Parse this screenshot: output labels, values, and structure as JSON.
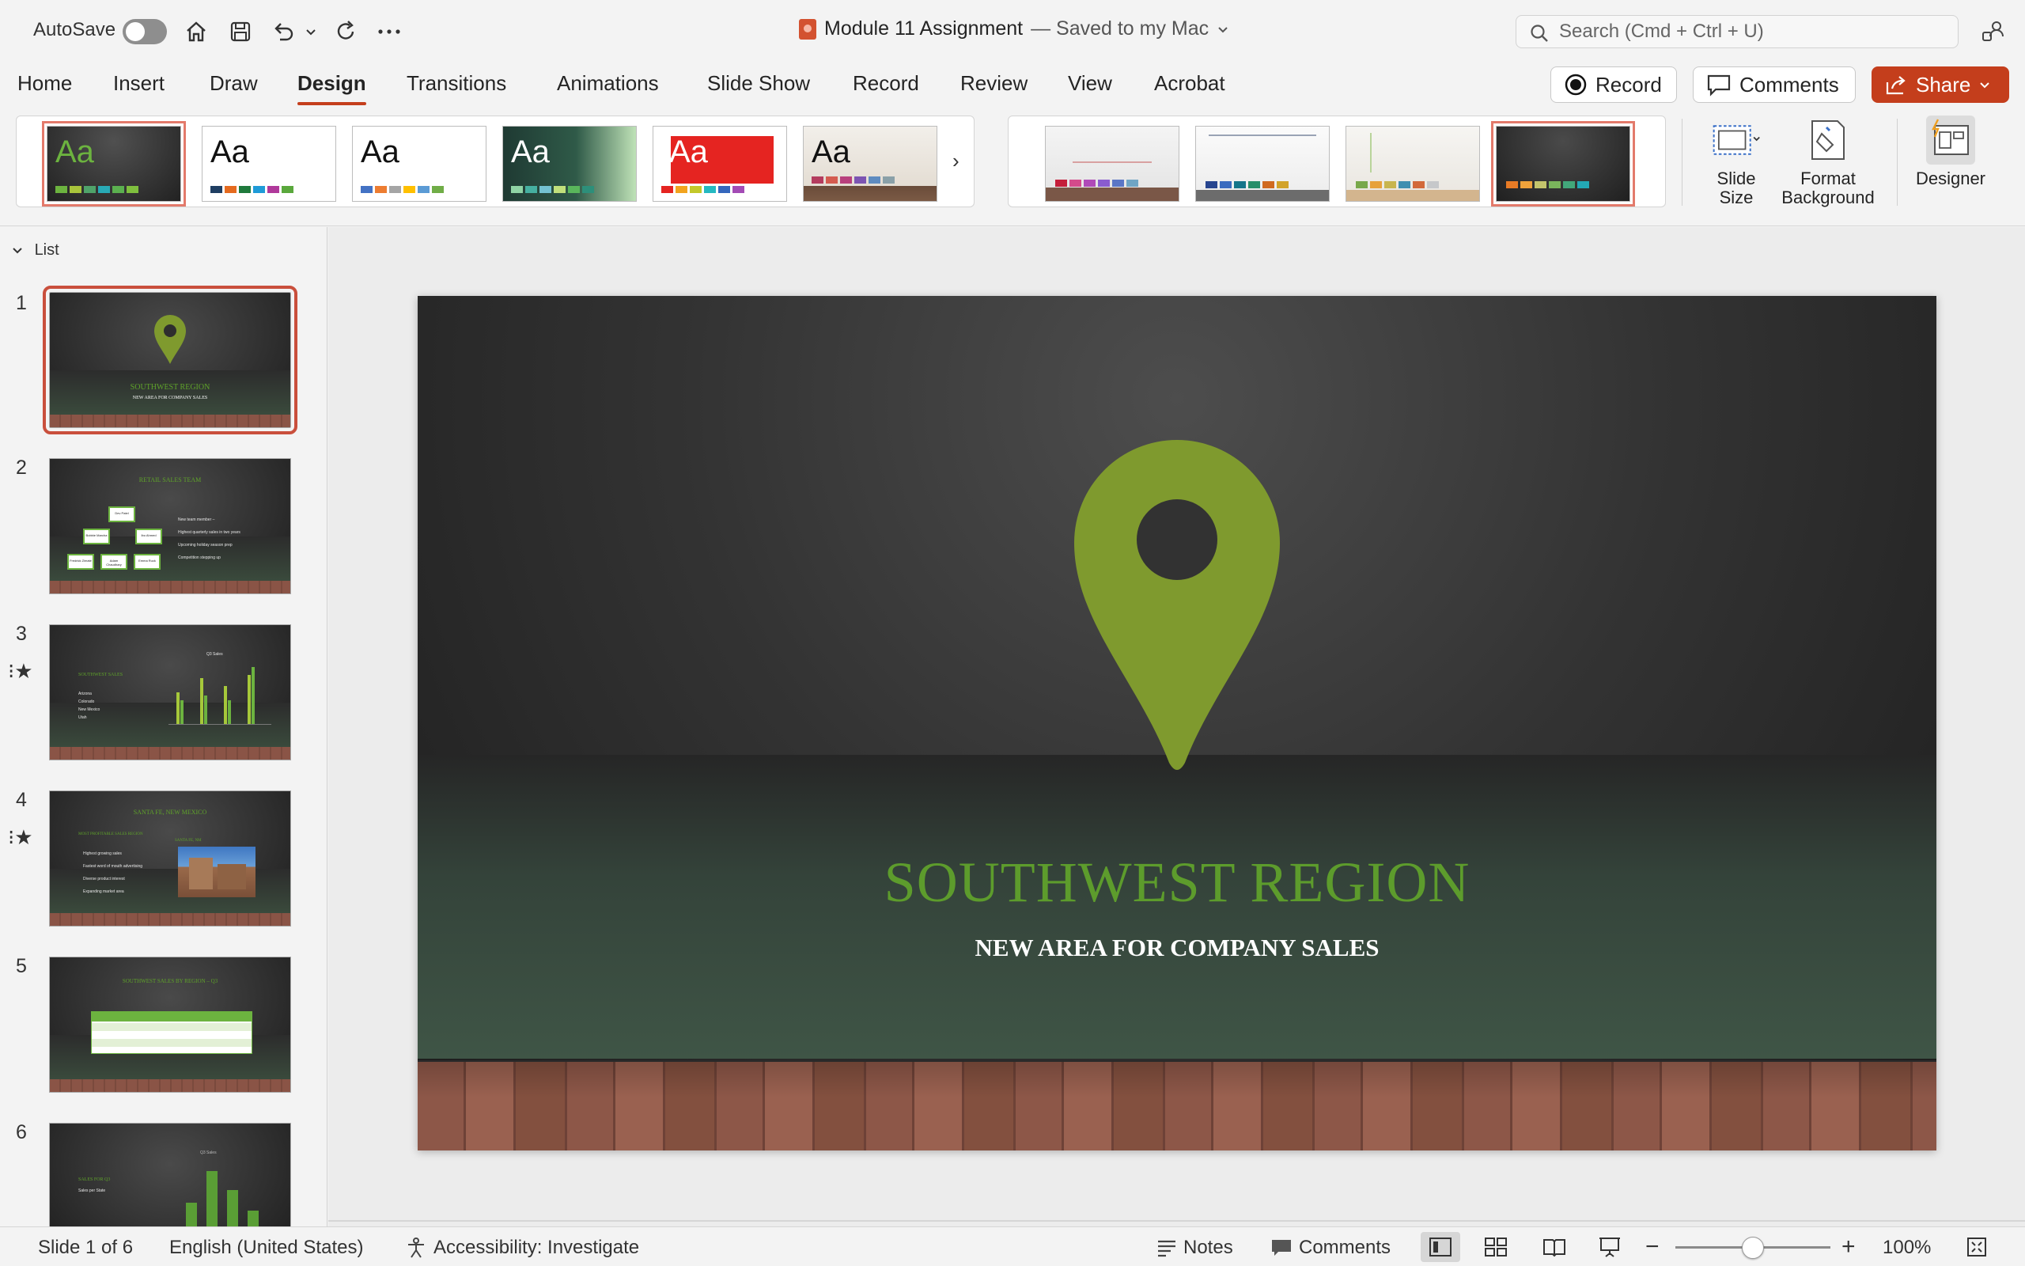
{
  "titlebar": {
    "autosave_label": "AutoSave",
    "doc_name": "Module 11 Assignment",
    "doc_status": "— Saved to my Mac",
    "search_placeholder": "Search (Cmd + Ctrl + U)"
  },
  "tabs": [
    "Home",
    "Insert",
    "Draw",
    "Design",
    "Transitions",
    "Animations",
    "Slide Show",
    "Record",
    "Review",
    "View",
    "Acrobat"
  ],
  "active_tab": "Design",
  "actions": {
    "record_label": "Record",
    "comments_label": "Comments",
    "share_label": "Share"
  },
  "themes": [
    {
      "name": "Aa",
      "bg": "#2b2b2b",
      "fg": "#6cb33f"
    },
    {
      "name": "Aa",
      "bg": "#ffffff",
      "fg": "#111111"
    },
    {
      "name": "Aa",
      "bg": "#ffffff",
      "fg": "#111111"
    },
    {
      "name": "Aa",
      "bg": "#23433a",
      "fg": "#ffffff"
    },
    {
      "name": "Aa",
      "bg": "#ffffff",
      "fg": "#ffffff"
    },
    {
      "name": "Aa",
      "bg": "#efebe5",
      "fg": "#111111"
    }
  ],
  "ribbon": {
    "slide_size_label1": "Slide",
    "slide_size_label2": "Size",
    "format_bg_label1": "Format",
    "format_bg_label2": "Background",
    "designer_label": "Designer"
  },
  "pane": {
    "list_label": "List",
    "slides": [
      {
        "num": "1",
        "title": "SOUTHWEST REGION",
        "sub": "NEW AREA FOR COMPANY SALES"
      },
      {
        "num": "2",
        "title": "RETAIL SALES TEAM",
        "org": [
          "Dev Patel",
          "Bobbie Marcha",
          "Ibo Ahmed",
          "Fredrick Zimate",
          "Adam Chaudhary",
          "Emma Ruck"
        ],
        "bullets": [
          "New team member –",
          "Highest quarterly sales in two years",
          "Upcoming holiday season prep",
          "Competition stepping up"
        ]
      },
      {
        "num": "3",
        "title": "SOUTHWEST SALES",
        "items": [
          "Arizona",
          "Colorado",
          "New Mexico",
          "Utah"
        ],
        "chart_title": "Q3 Sales"
      },
      {
        "num": "4",
        "title": "SANTA FE, NEW MEXICO",
        "left_title": "MOST PROFITABLE SALES REGION",
        "bullets": [
          "Highest growing sales",
          "Fastest word of mouth advertising",
          "Diverse product interest",
          "Expanding market area"
        ],
        "photo_caption": "SANTA FE, NM"
      },
      {
        "num": "5",
        "title": "SOUTHWEST SALES BY REGION – Q3"
      },
      {
        "num": "6",
        "title": "SALES FOR Q3",
        "sub": "Sales per State",
        "chart_title": "Q3 Sales"
      }
    ]
  },
  "slide": {
    "title": "SOUTHWEST REGION",
    "subtitle": "NEW AREA FOR COMPANY SALES"
  },
  "status": {
    "slide_of": "Slide 1 of 6",
    "language": "English (United States)",
    "accessibility": "Accessibility: Investigate",
    "notes": "Notes",
    "comments": "Comments",
    "zoom": "100%"
  },
  "colors": {
    "accent": "#c43e1c",
    "slide_green": "#5d9c2c"
  }
}
